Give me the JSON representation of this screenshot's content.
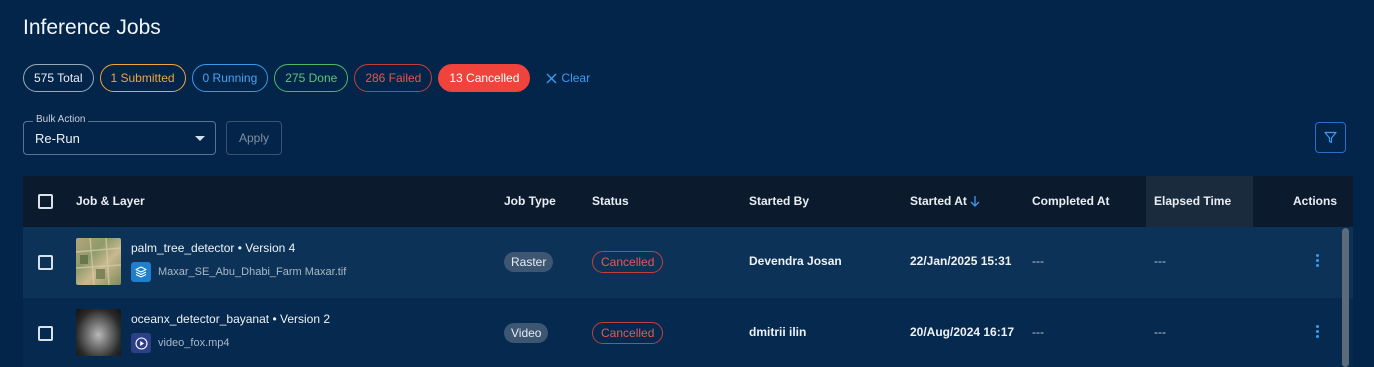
{
  "page": {
    "title": "Inference Jobs"
  },
  "filters": {
    "total": "575 Total",
    "submitted": "1 Submitted",
    "running": "0 Running",
    "done": "275 Done",
    "failed": "286 Failed",
    "cancelled": "13 Cancelled",
    "clear": "Clear"
  },
  "bulk": {
    "label": "Bulk Action",
    "value": "Re-Run",
    "apply": "Apply"
  },
  "table": {
    "columns": {
      "job": "Job & Layer",
      "type": "Job Type",
      "status": "Status",
      "started_by": "Started By",
      "started_at": "Started At",
      "completed_at": "Completed At",
      "elapsed": "Elapsed Time",
      "actions": "Actions"
    },
    "rows": [
      {
        "job": "palm_tree_detector • Version 4",
        "layer": "Maxar_SE_Abu_Dhabi_Farm Maxar.tif",
        "layer_icon": "stack-icon",
        "type": "Raster",
        "status": "Cancelled",
        "started_by": "Devendra Josan",
        "started_at": "22/Jan/2025 15:31",
        "completed_at": "---",
        "elapsed": "---"
      },
      {
        "job": "oceanx_detector_bayanat • Version 2",
        "layer": "video_fox.mp4",
        "layer_icon": "play-icon",
        "type": "Video",
        "status": "Cancelled",
        "started_by": "dmitrii ilin",
        "started_at": "20/Aug/2024 16:17",
        "completed_at": "---",
        "elapsed": "---"
      }
    ]
  },
  "colors": {
    "background": "#04254a",
    "accent": "#3d9bf0",
    "cancelled": "#f0433c",
    "submitted": "#f0a43a",
    "done": "#5fc27c"
  }
}
